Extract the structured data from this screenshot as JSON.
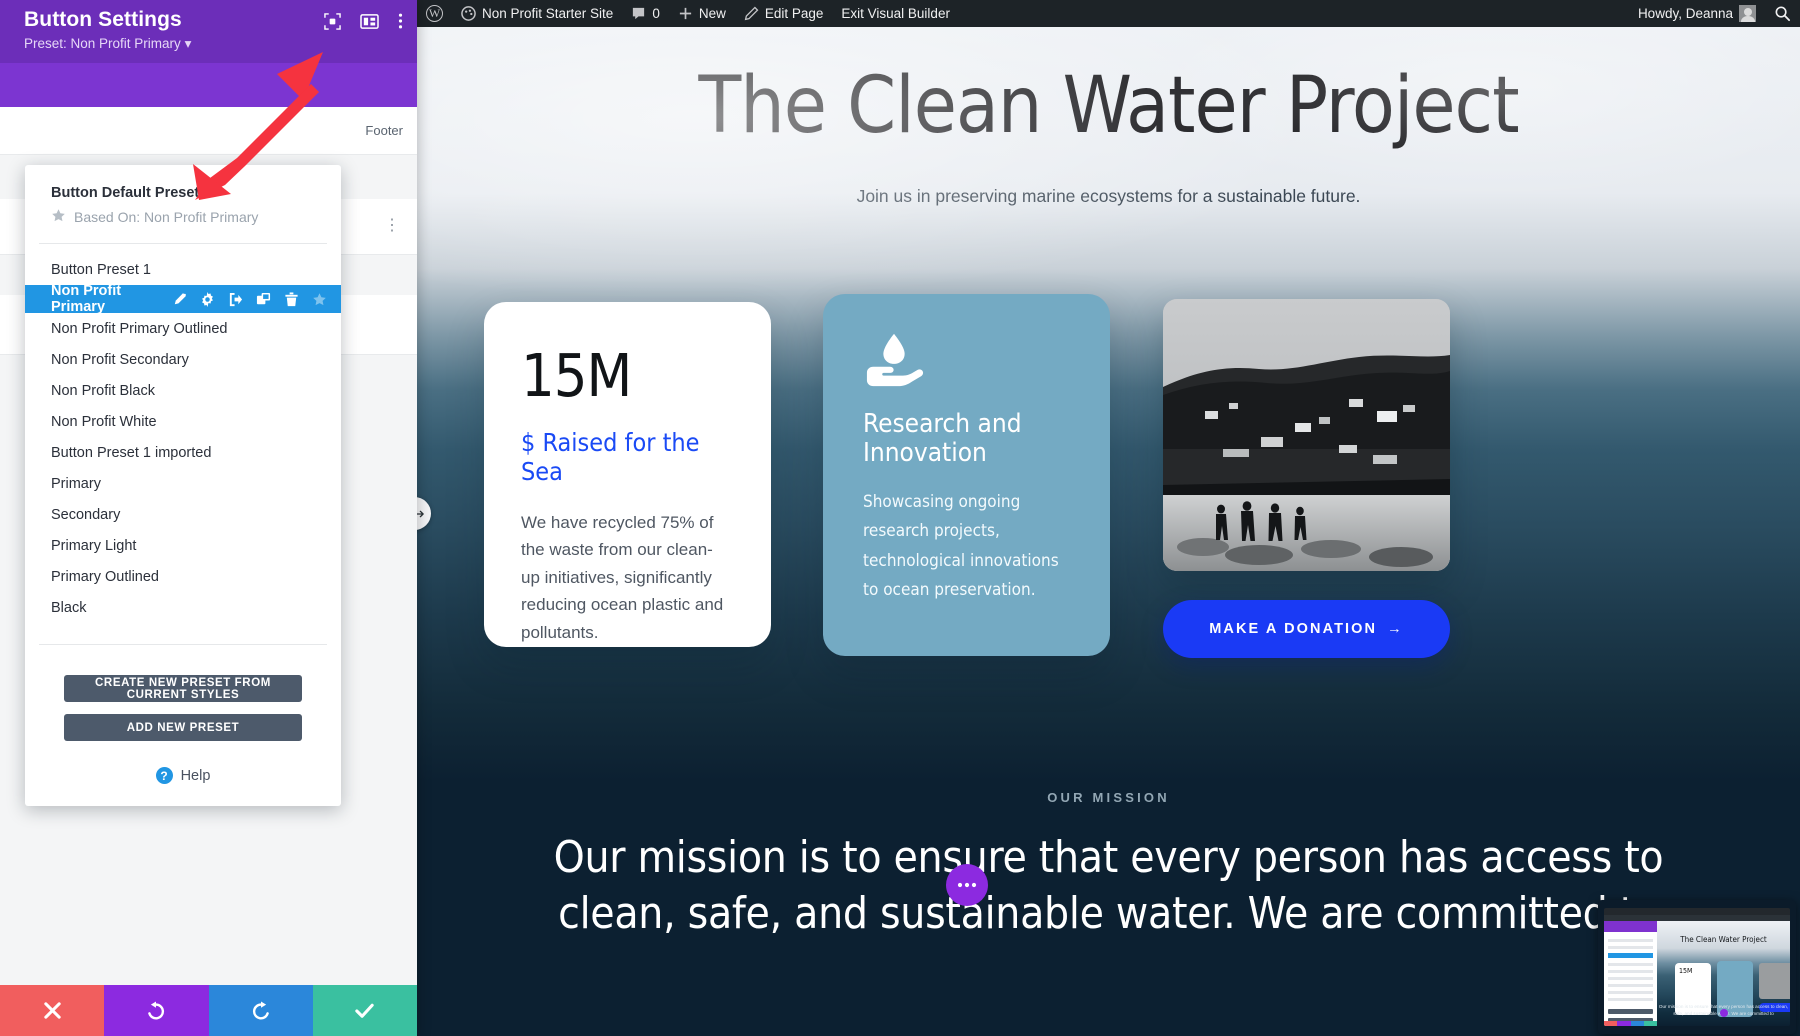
{
  "adminbar": {
    "items": [
      {
        "name": "wp-logo",
        "label": ""
      },
      {
        "name": "site-name",
        "label": "Non Profit Starter Site"
      },
      {
        "name": "comments",
        "label": "0"
      },
      {
        "name": "new",
        "label": "New"
      },
      {
        "name": "edit-page",
        "label": "Edit Page"
      },
      {
        "name": "exit-visual-builder",
        "label": "Exit Visual Builder"
      }
    ],
    "howdy": "Howdy, Deanna",
    "search_icon": "search-icon"
  },
  "panel": {
    "title": "Button Settings",
    "preset_line": "Preset: Non Profit Primary",
    "preset_caret": "▾",
    "header_icons": [
      "focus-target-icon",
      "layout-columns-icon",
      "vertical-dots-icon"
    ],
    "background_rows": [
      {
        "label": "Footer"
      }
    ],
    "dropdown": {
      "default_preset_title": "Button Default Preset",
      "based_on": "Based On: Non Profit Primary",
      "based_on_icon": "star-icon",
      "items": [
        {
          "label": "Button Preset 1",
          "selected": false
        },
        {
          "label": "Non Profit Primary",
          "selected": true
        },
        {
          "label": "Non Profit Primary Outlined",
          "selected": false
        },
        {
          "label": "Non Profit Secondary",
          "selected": false
        },
        {
          "label": "Non Profit Black",
          "selected": false
        },
        {
          "label": "Non Profit White",
          "selected": false
        },
        {
          "label": "Button Preset 1 imported",
          "selected": false
        },
        {
          "label": "Primary",
          "selected": false
        },
        {
          "label": "Secondary",
          "selected": false
        },
        {
          "label": "Primary Light",
          "selected": false
        },
        {
          "label": "Primary Outlined",
          "selected": false
        },
        {
          "label": "Black",
          "selected": false
        }
      ],
      "selected_item_actions": [
        "pencil-icon",
        "gear-icon",
        "export-icon",
        "duplicate-icon",
        "trash-icon",
        "star-icon"
      ],
      "create_preset_button": "CREATE NEW PRESET FROM CURRENT STYLES",
      "add_preset_button": "ADD NEW PRESET",
      "help_label": "Help",
      "help_icon": "question-circle-icon"
    },
    "actions": [
      {
        "name": "cancel-button",
        "icon": "close-icon",
        "color": "#f15e5e"
      },
      {
        "name": "undo-button",
        "icon": "undo-icon",
        "color": "#8c2ae0"
      },
      {
        "name": "redo-button",
        "icon": "redo-icon",
        "color": "#2b87da"
      },
      {
        "name": "save-button",
        "icon": "check-icon",
        "color": "#3ac0a0"
      }
    ]
  },
  "page": {
    "hero_title": "The Clean Water Project",
    "hero_subtitle": "Join us in preserving marine ecosystems for a sustainable future.",
    "stat_card": {
      "number": "15M",
      "label": "$ Raised for the Sea",
      "body": "We have recycled 75% of the waste from our clean-up initiatives, significantly reducing ocean plastic and pollutants."
    },
    "research_card": {
      "icon": "water-drop-in-hand-icon",
      "title": "Research and Innovation",
      "body": "Showcasing ongoing research projects, technological innovations to ocean preservation."
    },
    "photo_card": {
      "alt": "black-and-white beach and hillside houses with people standing on the shore"
    },
    "donate_button": {
      "label": "MAKE A DONATION",
      "arrow": "→"
    },
    "mission": {
      "eyebrow": "OUR MISSION",
      "heading": "Our mission is to ensure that every person has access to clean, safe, and sustainable water. We are committed to"
    },
    "colors": {
      "accent_blue": "#1a3af5",
      "link_blue": "#1a4af5",
      "card_teal": "#74aac3",
      "mission_bg": "#0c2031",
      "panel_purple": "#6c2eb9",
      "selected_row": "#2196e3"
    }
  },
  "overlay": {
    "resize_handle_icon": "horizontal-resize-icon",
    "floating_dots_icon": "ellipsis-icon",
    "annotation_arrow": "red-arrow-pointing-to-selected-preset-pencil",
    "thumbnail_title": "The Clean Water Project",
    "thumbnail_stat": "15M"
  }
}
